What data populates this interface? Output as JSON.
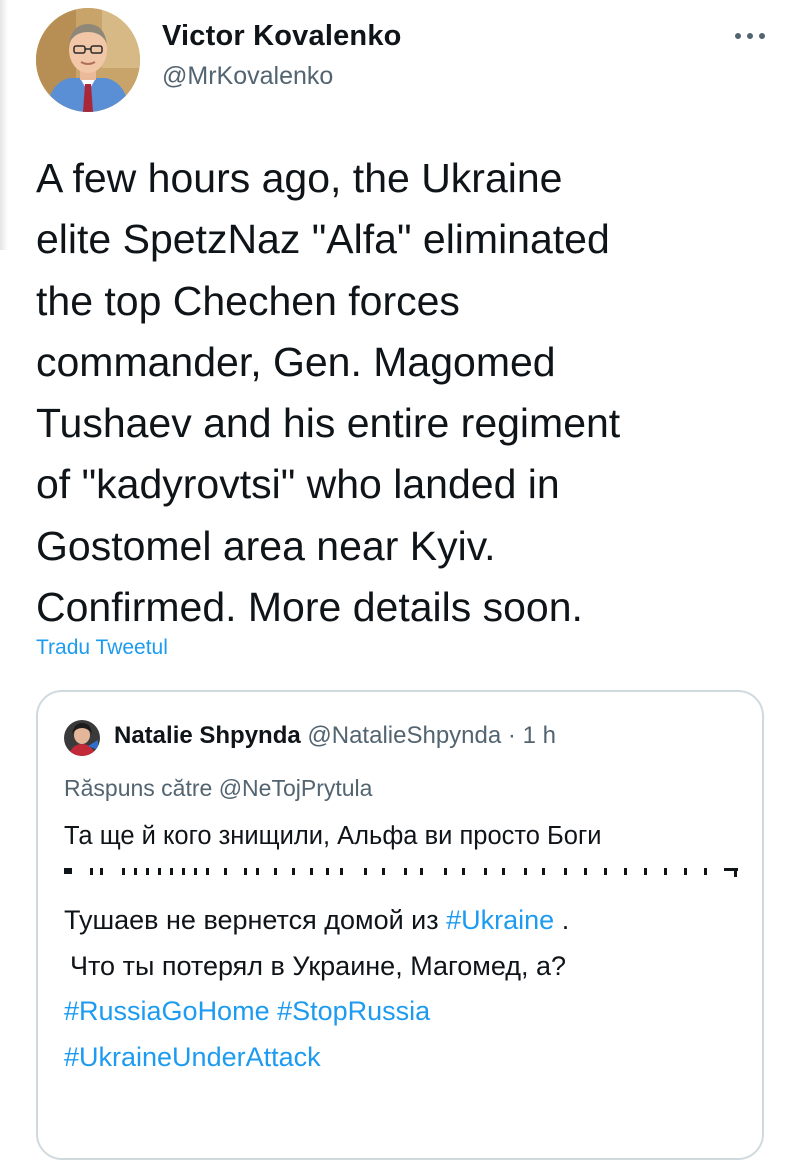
{
  "tweet": {
    "author": {
      "name": "Victor Kovalenko",
      "handle": "@MrKovalenko",
      "avatar_icon": "profile-photo"
    },
    "more_icon": "ellipsis-icon",
    "text_lines": [
      "A few hours ago, the Ukraine",
      "elite SpetzNaz \"Alfa\" eliminated",
      "the top Chechen forces",
      "commander, Gen. Magomed",
      "Tushaev and his entire regiment",
      "of \"kadyrovtsi\" who landed in",
      "Gostomel area near Kyiv.",
      "Confirmed. More details soon."
    ],
    "translate_label": "Tradu Tweetul"
  },
  "quote": {
    "name": "Natalie Shpynda",
    "handle": "@NatalieShpynda",
    "separator": "·",
    "time": "1 h",
    "reply_prefix": "Răspuns către",
    "reply_to": "@NeTojPrytula",
    "text": "Та ще й кого знищили, Альфа ви просто Боги",
    "body": {
      "line1_prefix": "Тушаев не вернется домой из",
      "hashtag_ukraine": "#Ukraine",
      "line1_suffix": ".",
      "line2": "Что ты потерял в Украине, Магомед, а?",
      "hashtag_russiagohome": "#RussiaGoHome",
      "hashtag_stoprussia": "#StopRussia",
      "hashtag_ukraineunderattack": "#UkraineUnderAttack"
    }
  },
  "colors": {
    "text": "#0f1419",
    "secondary": "#536471",
    "link": "#1d9bf0",
    "border": "#cfd9de"
  }
}
